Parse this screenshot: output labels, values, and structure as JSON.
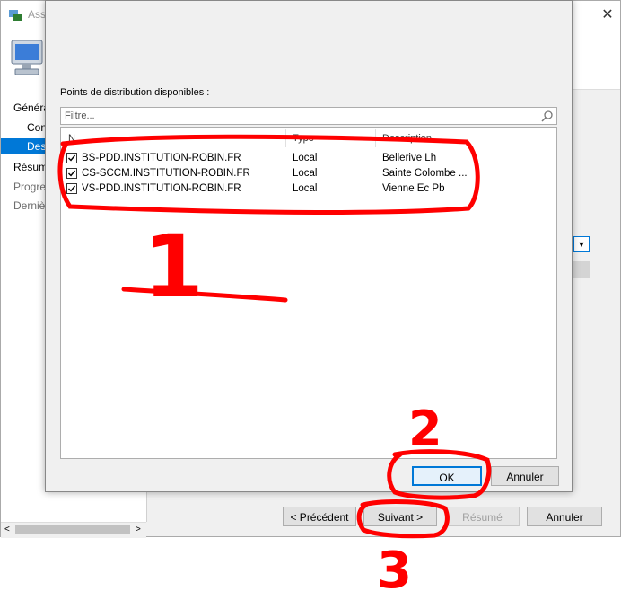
{
  "wizard": {
    "title": "Assi",
    "sidebar": {
      "items": [
        {
          "label": "Généra",
          "level": 0
        },
        {
          "label": "Con",
          "level": 1
        },
        {
          "label": "Dest",
          "level": 1,
          "selected": true
        },
        {
          "label": "Résum",
          "level": 0
        },
        {
          "label": "Progre",
          "level": 0,
          "dim": true
        },
        {
          "label": "Derniè",
          "level": 0,
          "dim": true
        }
      ]
    },
    "buttons": {
      "previous": "< Précédent",
      "next": "Suivant >",
      "summary": "Résumé",
      "cancel": "Annuler"
    }
  },
  "dialog": {
    "section_label": "Points de distribution disponibles :",
    "filter": {
      "placeholder": "Filtre...",
      "value": ""
    },
    "columns": {
      "name": "N",
      "type": "Type",
      "description": "Description"
    },
    "rows": [
      {
        "name": "BS-PDD.INSTITUTION-ROBIN.FR",
        "type": "Local",
        "description": "Bellerive Lh",
        "checked": true
      },
      {
        "name": "CS-SCCM.INSTITUTION-ROBIN.FR",
        "type": "Local",
        "description": "Sainte Colombe ...",
        "checked": true
      },
      {
        "name": "VS-PDD.INSTITUTION-ROBIN.FR",
        "type": "Local",
        "description": "Vienne Ec Pb",
        "checked": true
      }
    ],
    "ok_label": "OK",
    "cancel_label": "Annuler"
  },
  "annotations": {
    "one": "1",
    "two": "2",
    "three": "3",
    "color": "#ff0000"
  },
  "colors": {
    "accent": "#0078d7",
    "annotation": "#ff0000"
  }
}
